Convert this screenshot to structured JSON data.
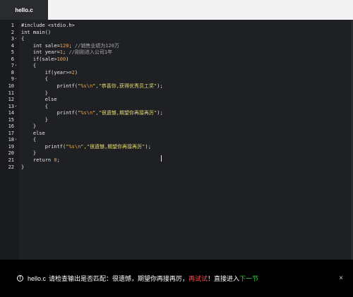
{
  "tab": {
    "label": "hello.c"
  },
  "code_lines": [
    {
      "n": "1",
      "fold": "",
      "tokens": [
        {
          "t": "#include <stdio.h>",
          "c": "k"
        }
      ]
    },
    {
      "n": "2",
      "fold": "",
      "tokens": [
        {
          "t": "int main()",
          "c": "k"
        }
      ]
    },
    {
      "n": "3",
      "fold": "▾",
      "tokens": [
        {
          "t": "{",
          "c": "k"
        }
      ]
    },
    {
      "n": "4",
      "fold": "",
      "tokens": [
        {
          "t": "    int sale=",
          "c": "k"
        },
        {
          "t": "120",
          "c": "n"
        },
        {
          "t": "; ",
          "c": "k"
        },
        {
          "t": "//销售业绩为120万",
          "c": "c"
        }
      ]
    },
    {
      "n": "5",
      "fold": "",
      "tokens": [
        {
          "t": "    int year=",
          "c": "k"
        },
        {
          "t": "1",
          "c": "n"
        },
        {
          "t": "; ",
          "c": "k"
        },
        {
          "t": "//刚刚进入公司1年",
          "c": "c"
        }
      ]
    },
    {
      "n": "6",
      "fold": "",
      "tokens": [
        {
          "t": "    if(sale>",
          "c": "k"
        },
        {
          "t": "100",
          "c": "n"
        },
        {
          "t": ")",
          "c": "k"
        }
      ]
    },
    {
      "n": "7",
      "fold": "▾",
      "tokens": [
        {
          "t": "    {",
          "c": "k"
        }
      ]
    },
    {
      "n": "8",
      "fold": "",
      "tokens": [
        {
          "t": "        if(year>=",
          "c": "k"
        },
        {
          "t": "2",
          "c": "n"
        },
        {
          "t": ")",
          "c": "k"
        }
      ]
    },
    {
      "n": "9",
      "fold": "▾",
      "tokens": [
        {
          "t": "        {",
          "c": "k"
        }
      ]
    },
    {
      "n": "10",
      "fold": "",
      "tokens": [
        {
          "t": "            printf(",
          "c": "k"
        },
        {
          "t": "\"",
          "c": "s"
        },
        {
          "t": "%s\\n",
          "c": "e"
        },
        {
          "t": "\",\"恭喜你,获得优秀员工奖\"",
          "c": "s"
        },
        {
          "t": ");",
          "c": "k"
        }
      ]
    },
    {
      "n": "11",
      "fold": "",
      "tokens": [
        {
          "t": "        }",
          "c": "k"
        }
      ]
    },
    {
      "n": "12",
      "fold": "",
      "tokens": [
        {
          "t": "        else",
          "c": "k"
        }
      ]
    },
    {
      "n": "13",
      "fold": "▾",
      "tokens": [
        {
          "t": "        {",
          "c": "k"
        }
      ]
    },
    {
      "n": "14",
      "fold": "",
      "tokens": [
        {
          "t": "            printf(",
          "c": "k"
        },
        {
          "t": "\"",
          "c": "s"
        },
        {
          "t": "%s\\n",
          "c": "e"
        },
        {
          "t": "\",\"很遗憾,期望你再接再厉\"",
          "c": "s"
        },
        {
          "t": ");",
          "c": "k"
        }
      ]
    },
    {
      "n": "15",
      "fold": "",
      "tokens": [
        {
          "t": "        }",
          "c": "k"
        }
      ]
    },
    {
      "n": "16",
      "fold": "",
      "tokens": [
        {
          "t": "    }",
          "c": "k"
        }
      ]
    },
    {
      "n": "17",
      "fold": "",
      "tokens": [
        {
          "t": "    else",
          "c": "k"
        }
      ]
    },
    {
      "n": "18",
      "fold": "▾",
      "tokens": [
        {
          "t": "    {",
          "c": "k"
        }
      ]
    },
    {
      "n": "19",
      "fold": "",
      "tokens": [
        {
          "t": "        printf(",
          "c": "k"
        },
        {
          "t": "\"",
          "c": "s"
        },
        {
          "t": "%s\\n",
          "c": "e"
        },
        {
          "t": "\",\"很遗憾,期望你再接再厉\"",
          "c": "s"
        },
        {
          "t": ");",
          "c": "k"
        }
      ]
    },
    {
      "n": "20",
      "fold": "",
      "tokens": [
        {
          "t": "    }",
          "c": "k"
        }
      ]
    },
    {
      "n": "21",
      "fold": "",
      "tokens": [
        {
          "t": "    return ",
          "c": "k"
        },
        {
          "t": "0",
          "c": "n"
        },
        {
          "t": ";",
          "c": "k"
        }
      ]
    },
    {
      "n": "22",
      "fold": "",
      "tokens": [
        {
          "t": "}",
          "c": "k"
        }
      ]
    }
  ],
  "notice": {
    "icon": "info-circle-icon",
    "file": "hello.c",
    "message": "请检查输出是否匹配：很遗憾，期望你再接再厉，",
    "retry_link": "再试试",
    "separator": "！直接进入",
    "next_link": "下一节",
    "close_icon": "close-icon",
    "close_glyph": "×"
  },
  "colors": {
    "background": "#1e2023",
    "tab_bar": "#f3f3f3",
    "retry": "#ff4d4d",
    "next": "#35c84a"
  }
}
